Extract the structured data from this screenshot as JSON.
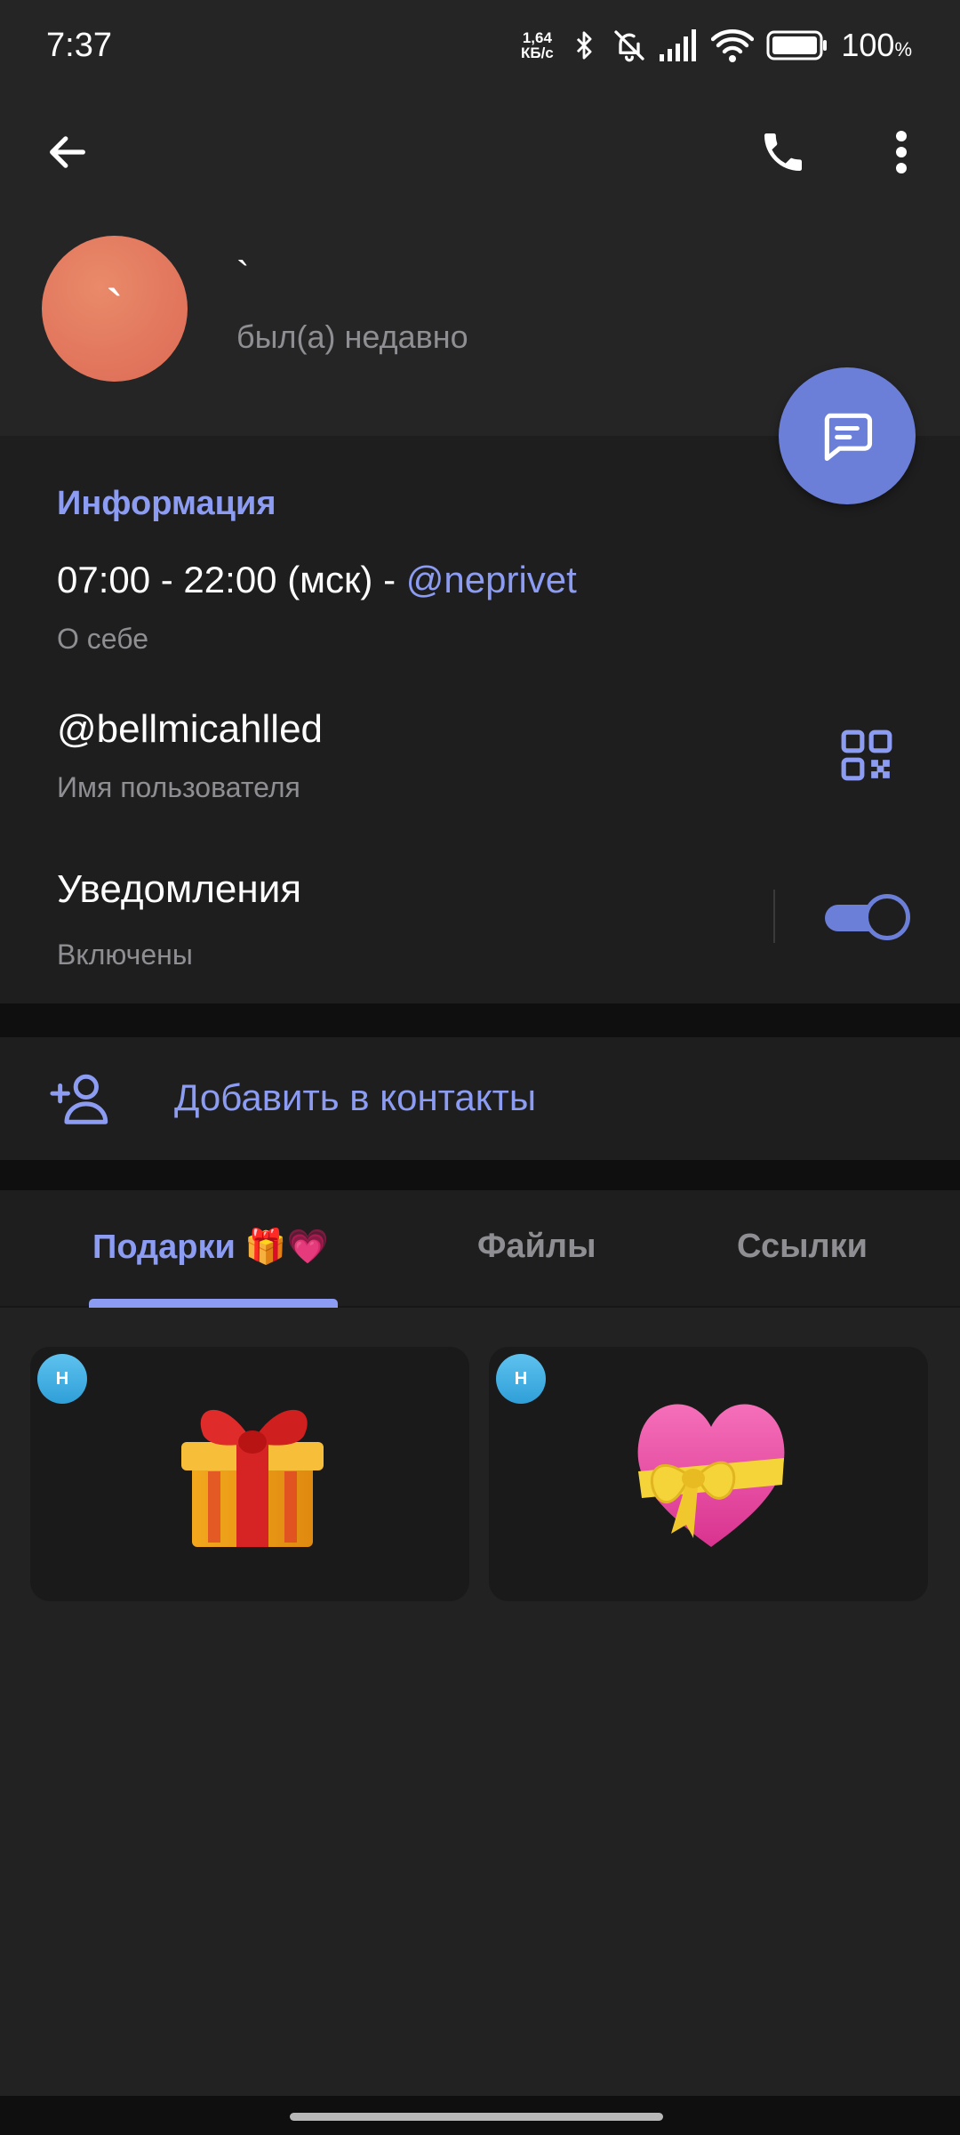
{
  "status_bar": {
    "time": "7:37",
    "net_speed_value": "1,64",
    "net_speed_unit": "КБ/с",
    "battery": "100",
    "battery_unit": "%"
  },
  "header": {
    "back_icon": "arrow-left-icon",
    "call_icon": "phone-icon",
    "menu_icon": "more-vert-icon"
  },
  "profile": {
    "avatar_initial": "`",
    "name": "`",
    "status": "был(а) недавно",
    "fab_icon": "message-icon"
  },
  "info": {
    "title": "Информация",
    "bio_text": "07:00 - 22:00 (мск) - ",
    "bio_mention": "@neprivet",
    "bio_label": "О себе",
    "username": "@bellmicahlled",
    "username_label": "Имя пользователя",
    "qr_icon": "qr-code-icon",
    "notifications_title": "Уведомления",
    "notifications_status": "Включены",
    "notifications_enabled": true
  },
  "actions": {
    "add_contact_icon": "add-person-icon",
    "add_contact_label": "Добавить в контакты"
  },
  "tabs": [
    {
      "label": "Подарки 🎁💗",
      "active": true
    },
    {
      "label": "Файлы",
      "active": false
    },
    {
      "label": "Ссылки",
      "active": false
    }
  ],
  "gifts": [
    {
      "badge": "H",
      "icon": "gift-box-icon"
    },
    {
      "badge": "H",
      "icon": "heart-ribbon-icon"
    }
  ],
  "colors": {
    "accent": "#8c9cf2",
    "fab": "#6b7fd8",
    "background": "#222222",
    "section": "#1e1e1f",
    "avatar": "#dd6a55"
  }
}
